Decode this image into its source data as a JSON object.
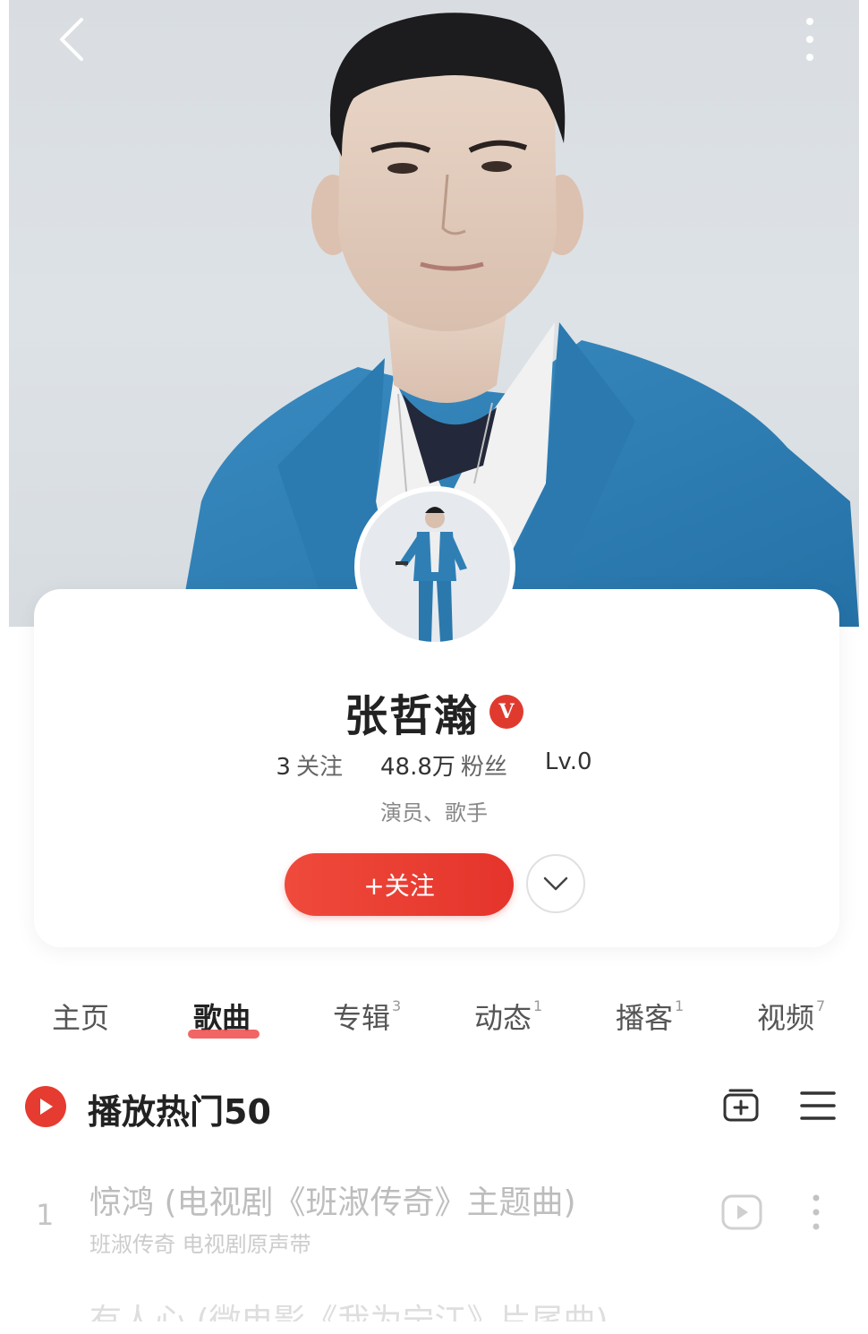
{
  "artist": {
    "name": "张哲瀚",
    "verified_badge": "V",
    "following_count": "3",
    "following_label": "关注",
    "fans_count": "48.8万",
    "fans_label": "粉丝",
    "level": "Lv.0",
    "bio": "演员、歌手"
  },
  "actions": {
    "follow_label": "+关注"
  },
  "tabs": [
    {
      "label": "主页",
      "count": ""
    },
    {
      "label": "歌曲",
      "count": ""
    },
    {
      "label": "专辑",
      "count": "3"
    },
    {
      "label": "动态",
      "count": "1"
    },
    {
      "label": "播客",
      "count": "1"
    },
    {
      "label": "视频",
      "count": "7"
    }
  ],
  "active_tab": "歌曲",
  "section": {
    "title": "播放热门50"
  },
  "songs": [
    {
      "index": "1",
      "title": "惊鸿 (电视剧《班淑传奇》主题曲)",
      "subtitle": "班淑传奇 电视剧原声带"
    },
    {
      "index": "",
      "title": "有人心 (微电影《我为宁江》片尾曲)",
      "subtitle": ""
    }
  ],
  "colors": {
    "accent": "#e5342b",
    "jacket": "#2f7fb5",
    "background": "#dde2e6"
  },
  "icons": [
    "back-icon",
    "more-vertical-icon",
    "verified-icon",
    "chevron-down-icon",
    "play-circle-icon",
    "add-to-playlist-icon",
    "list-menu-icon",
    "video-play-icon",
    "more-icon"
  ]
}
